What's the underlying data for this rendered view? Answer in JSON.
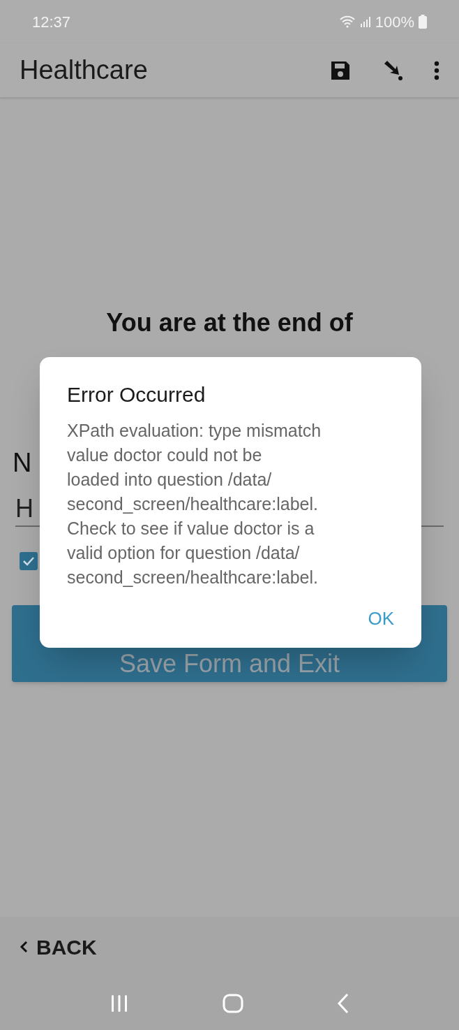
{
  "status_bar": {
    "time": "12:37",
    "battery": "100%"
  },
  "app_bar": {
    "title": "Healthcare"
  },
  "form": {
    "heading": "You are at the end of",
    "name_label": "N",
    "name_value": "H",
    "checkbox": {
      "checked": true
    },
    "save_button": "Save Form and Exit"
  },
  "dialog": {
    "title": "Error Occurred",
    "message_lines": [
      "XPath evaluation: type mismatch",
      "value doctor could not be",
      "loaded into question /data/",
      "second_screen/healthcare:label.",
      "Check to see if value doctor is a",
      "valid option for question /data/",
      "second_screen/healthcare:label."
    ],
    "button": "OK"
  },
  "bottom_bar": {
    "back": "BACK"
  }
}
